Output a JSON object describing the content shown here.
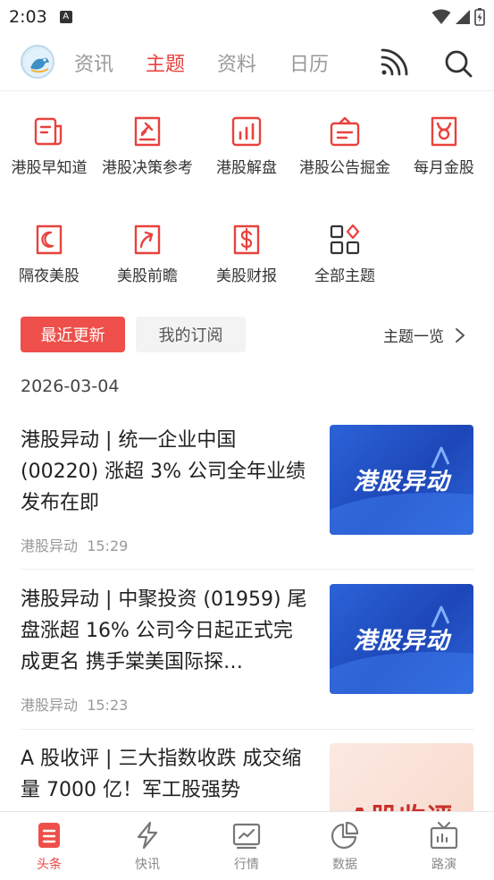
{
  "status": {
    "time": "2:03",
    "notif_letter": "A"
  },
  "nav": {
    "tabs": [
      "资讯",
      "主题",
      "资料",
      "日历"
    ],
    "active_tab": "主题"
  },
  "topics": [
    {
      "label": "港股早知道",
      "icon": "newspaper-icon"
    },
    {
      "label": "港股决策参考",
      "icon": "gavel-icon"
    },
    {
      "label": "港股解盘",
      "icon": "bar-chart-icon"
    },
    {
      "label": "港股公告掘金",
      "icon": "bag-icon"
    },
    {
      "label": "每月金股",
      "icon": "trophy-icon"
    },
    {
      "label": "隔夜美股",
      "icon": "moon-icon"
    },
    {
      "label": "美股前瞻",
      "icon": "trend-arrow-icon"
    },
    {
      "label": "美股财报",
      "icon": "dollar-doc-icon"
    },
    {
      "label": "全部主题",
      "icon": "grid-icon"
    }
  ],
  "filters": {
    "recent": "最近更新",
    "subscribed": "我的订阅",
    "topic_list": "主题一览"
  },
  "date": "2026-03-04",
  "articles": [
    {
      "title": "港股异动 | 统一企业中国 (00220) 涨超 3% 公司全年业绩发布在即",
      "source": "港股异动",
      "time": "15:29",
      "thumb_text": "港股异动"
    },
    {
      "title": "港股异动 | 中聚投资 (01959) 尾盘涨超 16% 公司今日起正式完成更名 携手棠美国际探…",
      "source": "港股异动",
      "time": "15:23",
      "thumb_text": "港股异动"
    },
    {
      "title": "A 股收评 | 三大指数收跌 成交缩量 7000 亿！军工股强势",
      "source": "",
      "time": "",
      "thumb_text": "A股收评"
    }
  ],
  "bottom_tabs": [
    "头条",
    "快讯",
    "行情",
    "数据",
    "路演"
  ],
  "colors": {
    "accent": "#e8423d",
    "muted": "#999999"
  }
}
